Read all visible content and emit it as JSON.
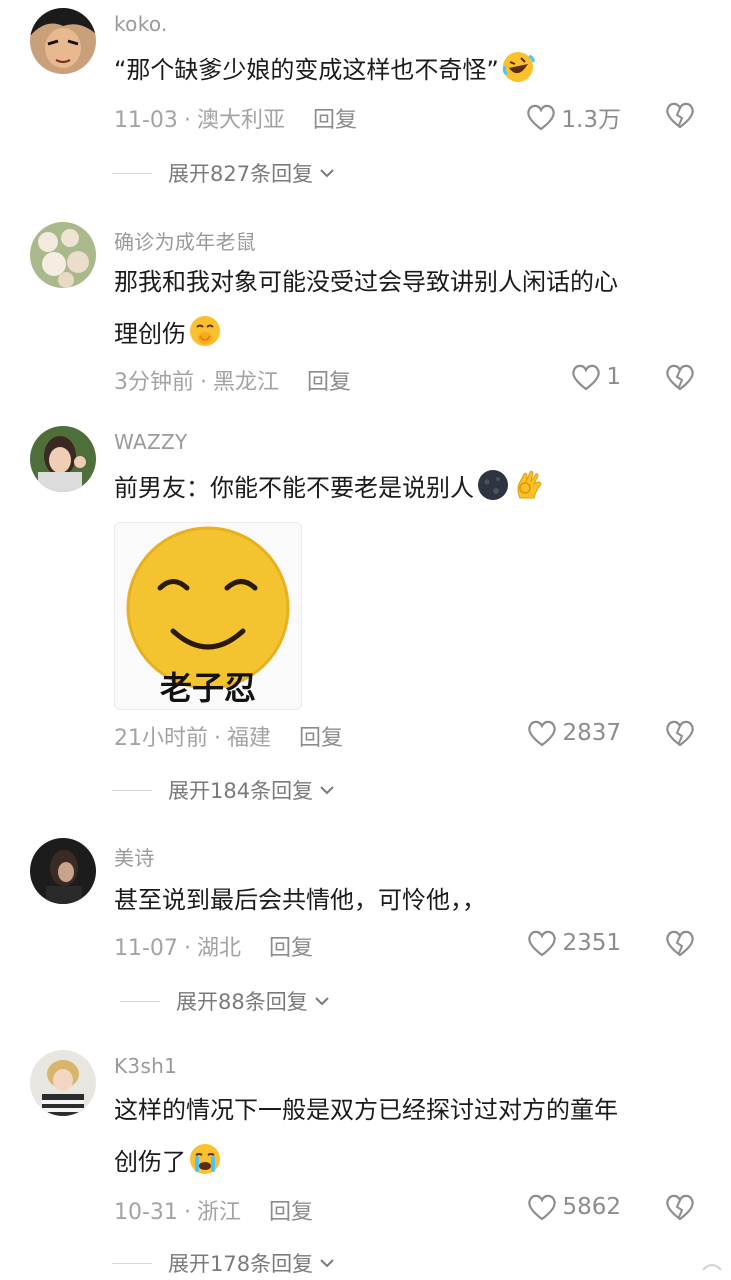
{
  "comments": [
    {
      "username": "koko.",
      "text": "“那个缺爹少娘的变成这样也不奇怪”",
      "emoji": "rofl-emoji",
      "time": "11-03",
      "location": "澳大利亚",
      "reply_label": "回复",
      "likes": "1.3万",
      "expand_label": "展开827条回复"
    },
    {
      "username": "确诊为成年老鼠",
      "text_line1": "那我和我对象可能没受过会导致讲别人闲话的心",
      "text_line2": "理创伤",
      "emoji": "shushing-emoji",
      "time": "3分钟前",
      "location": "黑龙江",
      "reply_label": "回复",
      "likes": "1"
    },
    {
      "username": "WAZZY",
      "text": "前男友：你能不能不要老是说别人",
      "emoji": "new-moon-face-emoji, ok-hand-emoji",
      "sticker_label": "老子忍",
      "time": "21小时前",
      "location": "福建",
      "reply_label": "回复",
      "likes": "2837",
      "expand_label": "展开184条回复"
    },
    {
      "username": "美诗",
      "text": "甚至说到最后会共情他，可怜他，，",
      "time": "11-07",
      "location": "湖北",
      "reply_label": "回复",
      "likes": "2351",
      "expand_label": "展开88条回复"
    },
    {
      "username": "K3sh1",
      "text_line1": "这样的情况下一般是双方已经探讨过对方的童年",
      "text_line2": "创伤了",
      "emoji": "loudly-crying-emoji",
      "time": "10-31",
      "location": "浙江",
      "reply_label": "回复",
      "likes": "5862",
      "expand_label": "展开178条回复"
    }
  ],
  "colors": {
    "meta": "#a3a3a3",
    "text": "#1b1b1b",
    "emoji_yellow": "#fbc02d"
  }
}
